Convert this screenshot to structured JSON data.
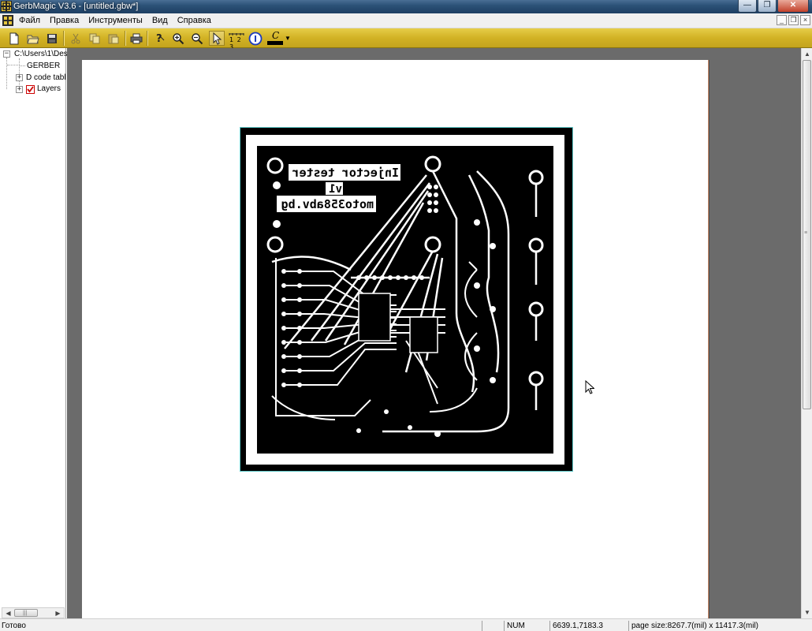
{
  "window": {
    "title": "GerbMagic V3.6 - [untitled.gbw*]",
    "buttons": {
      "minimize": "—",
      "maximize": "❐",
      "close": "✕"
    }
  },
  "menu": {
    "items": [
      "Файл",
      "Правка",
      "Инструменты",
      "Вид",
      "Справка"
    ]
  },
  "mdi_buttons": {
    "minimize": "_",
    "restore": "❐",
    "close": "×"
  },
  "toolbar": {
    "buttons": [
      {
        "name": "new-icon"
      },
      {
        "name": "open-icon"
      },
      {
        "name": "save-icon"
      },
      {
        "name": "cut-icon"
      },
      {
        "name": "copy-icon"
      },
      {
        "name": "paste-icon"
      },
      {
        "name": "print-icon"
      },
      {
        "name": "help-icon"
      },
      {
        "name": "zoom-in-icon"
      },
      {
        "name": "zoom-out-icon"
      },
      {
        "name": "select-pointer-icon"
      },
      {
        "name": "measure-ruler-icon"
      },
      {
        "name": "info-icon"
      },
      {
        "name": "color-icon"
      }
    ],
    "ruler_label": "1 2 3",
    "color_label": "C",
    "color_value": "#000000"
  },
  "tree": {
    "root": "C:\\Users\\1\\Des",
    "children": [
      "GERBER",
      "D code tabl",
      "Layers"
    ],
    "expander_collapsed": "+",
    "expander_expanded": "−"
  },
  "pcb": {
    "label_line1": "Injector tester",
    "label_line2": "v1",
    "label_line3": "moto358abv.bg"
  },
  "status": {
    "ready": "Готово",
    "num": "NUM",
    "coords": "6639.1,7183.3",
    "page_size": "page size:8267.7(mil) x 11417.3(mil)"
  },
  "colors": {
    "toolbar": "#d2b224",
    "titlebar": "#2c5278",
    "canvas": "#6b6b6b",
    "pcb_frame": "#5fc9c9"
  }
}
